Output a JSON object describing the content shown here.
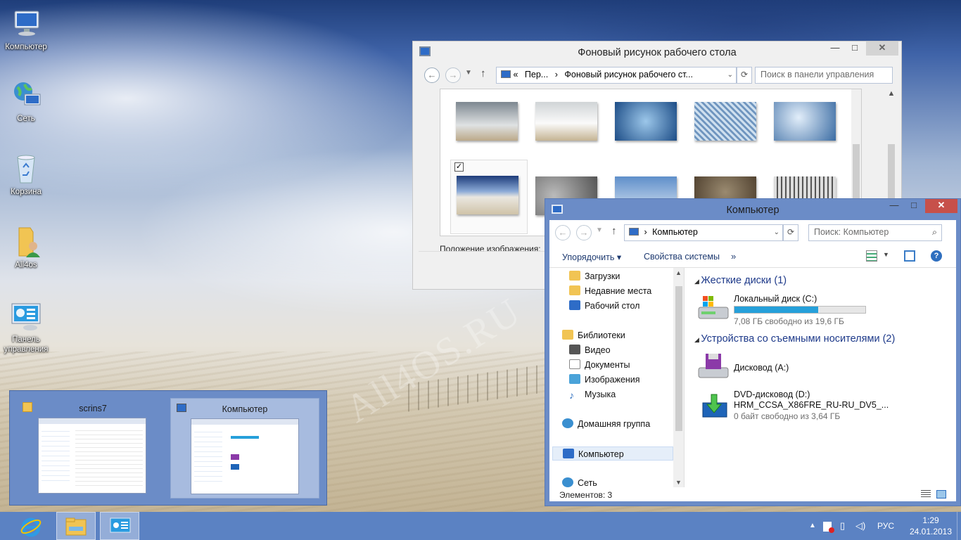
{
  "desktop": {
    "icons": [
      {
        "label": "Компьютер",
        "icon": "computer-icon"
      },
      {
        "label": "Сеть",
        "icon": "network-icon"
      },
      {
        "label": "Корзина",
        "icon": "recycle-bin-icon"
      },
      {
        "label": "All4os",
        "icon": "user-folder-icon"
      },
      {
        "label": "Панель управления",
        "icon": "control-panel-icon"
      }
    ],
    "watermark": "All4OS.RU"
  },
  "wallpaper_window": {
    "title": "Фоновый рисунок рабочего стола",
    "breadcrumb_prefix": "«",
    "breadcrumb_1": "Пер...",
    "breadcrumb_sep": "›",
    "breadcrumb_2": "Фоновый рисунок рабочего ст...",
    "search_placeholder": "Поиск в панели управления",
    "position_label": "Положение изображения:",
    "thumbnails_row1": [
      "frost-tree-1",
      "frost-tree-2",
      "frost-leaf",
      "frost-grass",
      "frost-ice"
    ],
    "thumbnails_row2": [
      "winter-field-selected",
      "stones",
      "snow-sky",
      "rusty-gear",
      "winter-forest"
    ],
    "selected_checked": true
  },
  "explorer_window": {
    "title": "Компьютер",
    "address": "Компьютер",
    "search_placeholder": "Поиск: Компьютер",
    "toolbar": {
      "organize": "Упорядочить",
      "system_props": "Свойства системы",
      "more": "»"
    },
    "nav": [
      {
        "label": "Загрузки",
        "icon": "downloads-icon"
      },
      {
        "label": "Недавние места",
        "icon": "recent-places-icon"
      },
      {
        "label": "Рабочий стол",
        "icon": "desktop-icon"
      },
      {
        "label": "Библиотеки",
        "icon": "libraries-icon"
      },
      {
        "label": "Видео",
        "icon": "video-icon"
      },
      {
        "label": "Документы",
        "icon": "documents-icon"
      },
      {
        "label": "Изображения",
        "icon": "pictures-icon"
      },
      {
        "label": "Музыка",
        "icon": "music-icon"
      },
      {
        "label": "Домашняя группа",
        "icon": "homegroup-icon"
      },
      {
        "label": "Компьютер",
        "icon": "computer-icon"
      },
      {
        "label": "Сеть",
        "icon": "network-icon"
      }
    ],
    "group_hard": "Жесткие диски (1)",
    "group_removable": "Устройства со съемными носителями (2)",
    "drive_c": {
      "name": "Локальный диск (C:)",
      "free": "7,08 ГБ свободно из 19,6 ГБ",
      "used_fraction": 0.64
    },
    "drive_a": {
      "name": "Дисковод (A:)"
    },
    "drive_d": {
      "name": "DVD-дисковод (D:)",
      "label": "HRM_CCSA_X86FRE_RU-RU_DV5_...",
      "free": "0 байт свободно из 3,64 ГБ"
    },
    "status": "Элементов: 3",
    "accent": "#26a0da"
  },
  "switcher": {
    "cards": [
      {
        "label": "scrins7",
        "icon": "folder-icon"
      },
      {
        "label": "Компьютер",
        "icon": "computer-icon"
      }
    ]
  },
  "taskbar": {
    "buttons": [
      "internet-explorer-icon",
      "file-explorer-icon",
      "control-panel-icon"
    ],
    "language": "РУС",
    "time": "1:29",
    "date": "24.01.2013"
  }
}
